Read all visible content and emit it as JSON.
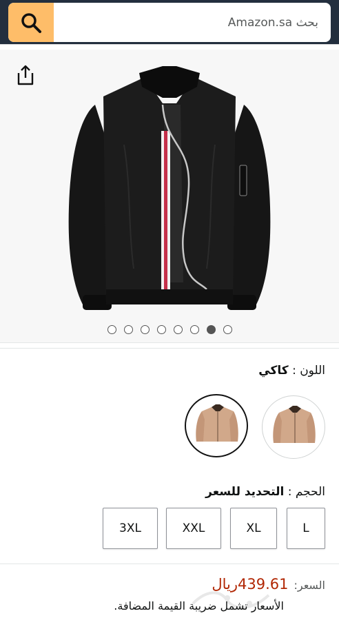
{
  "header": {
    "search_placeholder": "بحث Amazon.sa",
    "search_icon": "search-icon"
  },
  "gallery": {
    "image_count": 8,
    "active_index": 6,
    "product_image": "black bomber jacket with red-white stripe and silver zipper",
    "share_icon": "share-icon"
  },
  "color": {
    "label": "اللون :",
    "value": "كاكي",
    "swatches": [
      {
        "name": "khaki-jacket-front",
        "selected": false
      },
      {
        "name": "khaki-jacket-front-alt",
        "selected": true
      }
    ],
    "swatch_color": "#d1a88a"
  },
  "size": {
    "label": "الحجم :",
    "value": "التحديد للسعر",
    "options": [
      "L",
      "XL",
      "XXL",
      "3XL"
    ]
  },
  "price": {
    "label": "السعر:",
    "value": "439.61ريال",
    "vat_note": "الأسعار تشمل ضريبة القيمة المضافة."
  },
  "colors": {
    "header_bg": "#232f3e",
    "search_button": "#febd69",
    "price": "#b12704"
  }
}
